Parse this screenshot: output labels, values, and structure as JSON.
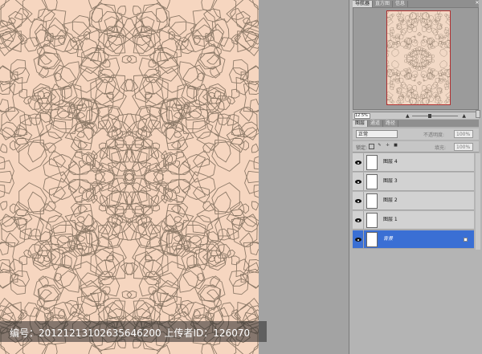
{
  "navigator": {
    "tabs": [
      "导航器",
      "直方图",
      "信息"
    ],
    "zoom": "12.5%"
  },
  "layers_panel": {
    "tabs": [
      "图层",
      "通道",
      "路径"
    ],
    "blend_mode": "正常",
    "opacity_label": "不透明度:",
    "opacity_value": "100%",
    "lock_label": "锁定:",
    "fill_label": "填充:",
    "fill_value": "100%",
    "layers": [
      {
        "name": "图层 4",
        "selected": false
      },
      {
        "name": "图层 3",
        "selected": false
      },
      {
        "name": "图层 2",
        "selected": false
      },
      {
        "name": "图层 1",
        "selected": false
      },
      {
        "name": "背景",
        "selected": true
      }
    ]
  },
  "watermark": "编号：20121213102635646200 上传者ID：126070",
  "colors": {
    "canvas": "#f6d6c0",
    "pattern_line": "#8d7a68",
    "selected_layer": "#3a6fd4"
  }
}
